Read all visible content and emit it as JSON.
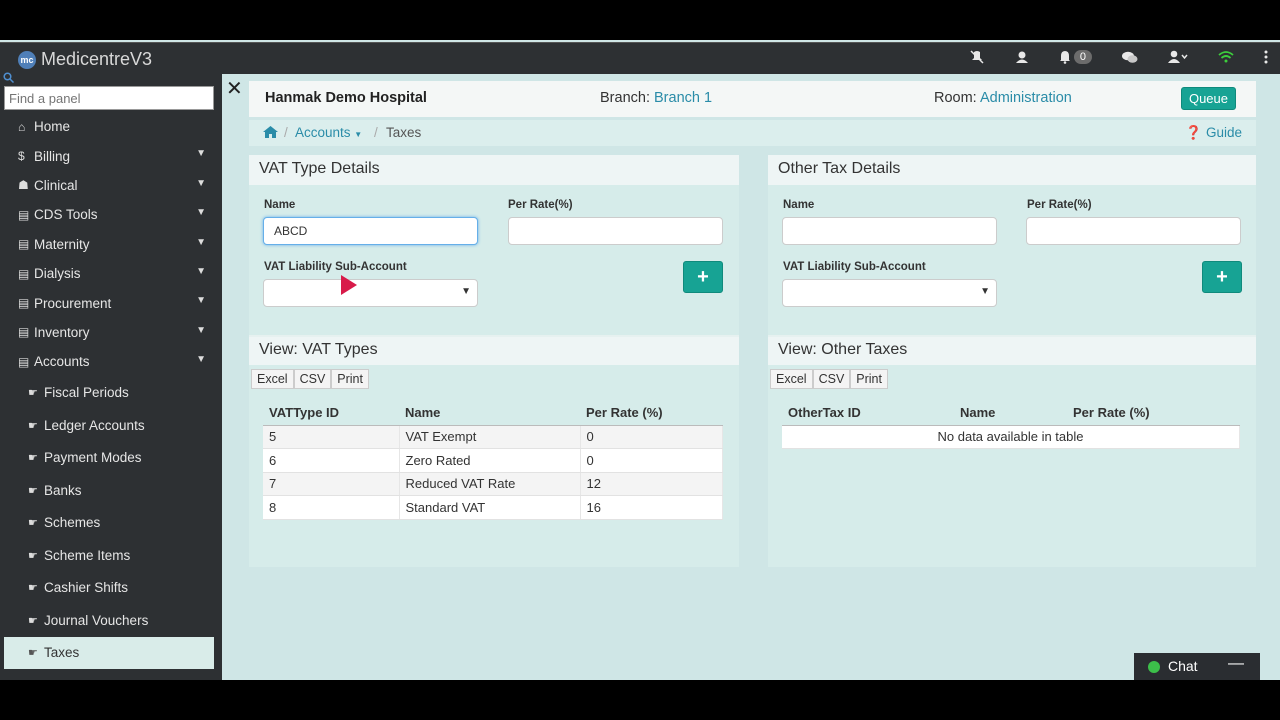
{
  "app": {
    "title": "MedicentreV3",
    "logo_text": "mc"
  },
  "navbar": {
    "icons": [
      "mute-icon",
      "user-circle-icon",
      "bell-icon",
      "chat-bubbles-icon",
      "user-icon",
      "wifi-icon",
      "more-vertical-icon"
    ],
    "notifications_count": "0"
  },
  "sidebar": {
    "search_placeholder": "Find a panel",
    "items": [
      {
        "label": "Home",
        "icon": "home-icon"
      },
      {
        "label": "Billing",
        "icon": "dollar-icon"
      },
      {
        "label": "Clinical",
        "icon": "user-md-icon"
      },
      {
        "label": "CDS Tools",
        "icon": "book-icon"
      },
      {
        "label": "Maternity",
        "icon": "book-icon"
      },
      {
        "label": "Dialysis",
        "icon": "book-icon"
      },
      {
        "label": "Procurement",
        "icon": "book-icon"
      },
      {
        "label": "Inventory",
        "icon": "book-icon"
      },
      {
        "label": "Accounts",
        "icon": "book-icon"
      }
    ],
    "sub_items": [
      {
        "label": "Fiscal Periods"
      },
      {
        "label": "Ledger Accounts"
      },
      {
        "label": "Payment Modes"
      },
      {
        "label": "Banks"
      },
      {
        "label": "Schemes"
      },
      {
        "label": "Scheme Items"
      },
      {
        "label": "Cashier Shifts"
      },
      {
        "label": "Journal Vouchers"
      },
      {
        "label": "Taxes"
      }
    ]
  },
  "header": {
    "hospital": "Hanmak Demo Hospital",
    "branch_label": "Branch:",
    "branch_value": "Branch 1",
    "room_label": "Room:",
    "room_value": "Administration",
    "queue_label": "Queue"
  },
  "breadcrumb": {
    "accounts": "Accounts",
    "taxes": "Taxes",
    "guide": "Guide"
  },
  "vat_panel": {
    "title": "VAT Type Details",
    "name_label": "Name",
    "name_value": "ABCD",
    "rate_label": "Per Rate(%)",
    "rate_value": "",
    "account_label": "VAT Liability Sub-Account",
    "view_title": "View: VAT Types",
    "export_buttons": [
      "Excel",
      "CSV",
      "Print"
    ],
    "columns": [
      "VATType ID",
      "Name",
      "Per Rate (%)"
    ],
    "rows": [
      [
        "5",
        "VAT Exempt",
        "0"
      ],
      [
        "6",
        "Zero Rated",
        "0"
      ],
      [
        "7",
        "Reduced VAT Rate",
        "12"
      ],
      [
        "8",
        "Standard VAT",
        "16"
      ]
    ]
  },
  "other_panel": {
    "title": "Other Tax Details",
    "name_label": "Name",
    "rate_label": "Per Rate(%)",
    "account_label": "VAT Liability Sub-Account",
    "view_title": "View: Other Taxes",
    "export_buttons": [
      "Excel",
      "CSV",
      "Print"
    ],
    "columns": [
      "OtherTax ID",
      "Name",
      "Per Rate (%)"
    ],
    "empty_message": "No data available in table"
  },
  "chat": {
    "label": "Chat",
    "minimize": "—"
  },
  "colors": {
    "accent": "#17a394",
    "link": "#2a8ca8",
    "sidebar": "#2d3033"
  }
}
